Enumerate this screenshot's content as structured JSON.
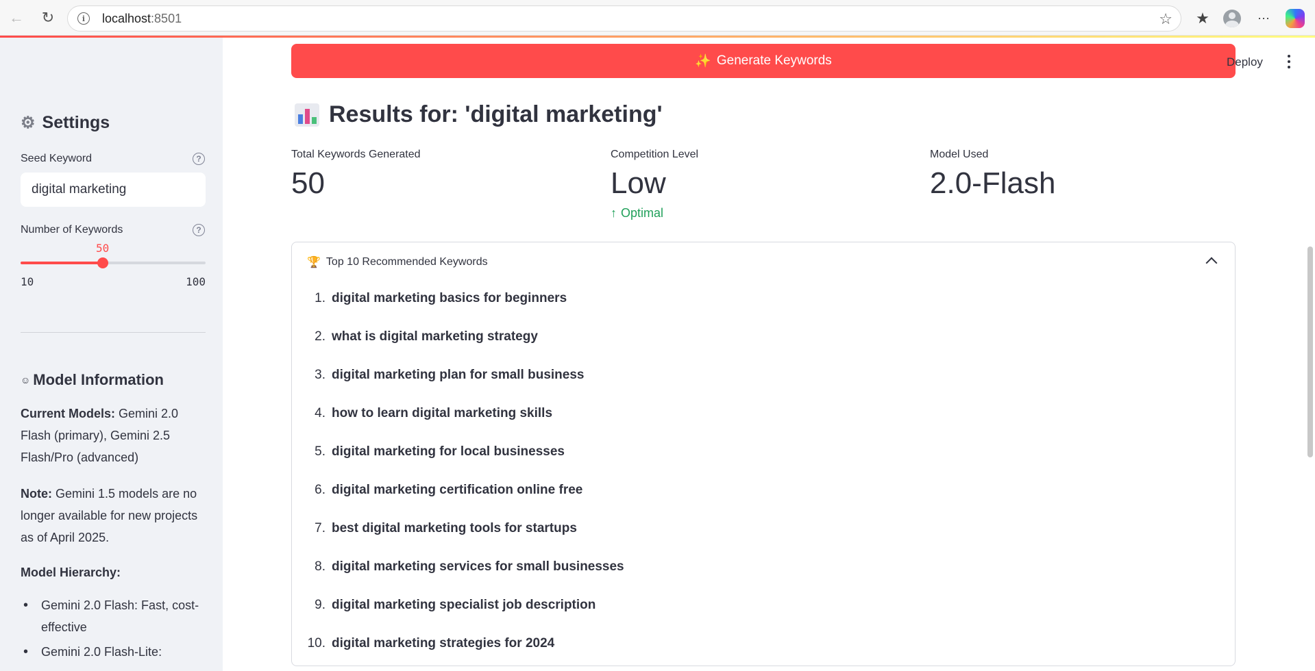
{
  "browser": {
    "url_host": "localhost",
    "url_port": ":8501"
  },
  "sidebar": {
    "settings_title": "Settings",
    "seed_keyword_label": "Seed Keyword",
    "seed_keyword_value": "digital marketing",
    "num_keywords_label": "Number of Keywords",
    "num_keywords_value": "50",
    "num_keywords_min": "10",
    "num_keywords_max": "100",
    "num_keywords_fraction": 0.444,
    "model_info_title": "Model Information",
    "current_models_label": "Current Models:",
    "current_models_text": " Gemini 2.0 Flash (primary), Gemini 2.5 Flash/Pro (advanced)",
    "note_label": "Note:",
    "note_text": " Gemini 1.5 models are no longer available for new projects as of April 2025.",
    "hierarchy_label": "Model Hierarchy:",
    "hierarchy_items": [
      "Gemini 2.0 Flash: Fast, cost-effective",
      "Gemini 2.0 Flash-Lite:"
    ]
  },
  "main": {
    "generate_button": "Generate Keywords",
    "deploy_label": "Deploy",
    "results_title": "Results for: 'digital marketing'",
    "metrics": [
      {
        "label": "Total Keywords Generated",
        "value": "50"
      },
      {
        "label": "Competition Level",
        "value": "Low",
        "delta": "Optimal"
      },
      {
        "label": "Model Used",
        "value": "2.0-Flash"
      }
    ],
    "expander_title": "Top 10 Recommended Keywords",
    "keywords": [
      "digital marketing basics for beginners",
      "what is digital marketing strategy",
      "digital marketing plan for small business",
      "how to learn digital marketing skills",
      "digital marketing for local businesses",
      "digital marketing certification online free",
      "best digital marketing tools for startups",
      "digital marketing services for small businesses",
      "digital marketing specialist job description",
      "digital marketing strategies for 2024"
    ]
  },
  "colors": {
    "primary": "#ff4b4b",
    "sidebar_bg": "#f0f2f6",
    "text": "#31333f",
    "delta_positive": "#21a05a"
  },
  "icons": [
    "back-icon",
    "reload-icon",
    "info-icon",
    "star-icon",
    "favorites-icon",
    "profile-icon",
    "more-icon",
    "copilot-icon",
    "gear-icon",
    "help-icon",
    "robot-icon",
    "sparkle-icon",
    "bar-chart-icon",
    "arrow-up-icon",
    "trophy-icon",
    "chevron-up-icon",
    "kebab-menu-icon"
  ]
}
